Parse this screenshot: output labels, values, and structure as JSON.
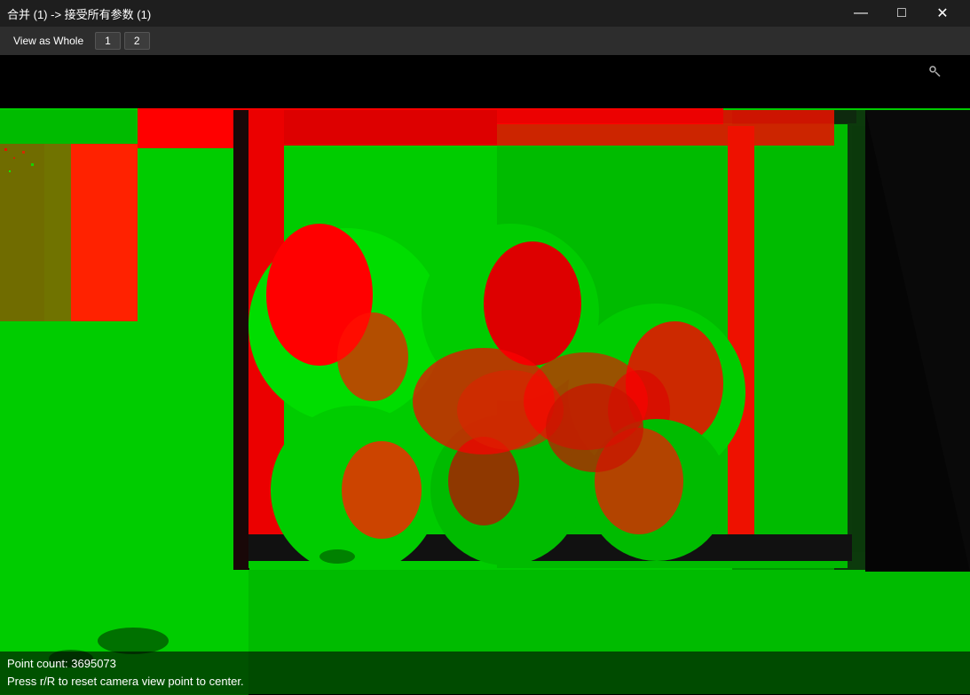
{
  "titlebar": {
    "title": "合并 (1) -> 接受所有参数 (1)",
    "minimize_label": "—",
    "maximize_label": "□",
    "close_label": "✕"
  },
  "toolbar": {
    "view_as_whole_label": "View as Whole",
    "tab1_label": "1",
    "tab2_label": "2"
  },
  "status": {
    "point_count": "Point count: 3695073",
    "hint": "Press r/R to reset camera view point to center."
  },
  "colors": {
    "green": "#00ff00",
    "red": "#ff0000",
    "black": "#000000",
    "dark_bg": "#1e1e1e",
    "toolbar_bg": "#2d2d2d"
  }
}
